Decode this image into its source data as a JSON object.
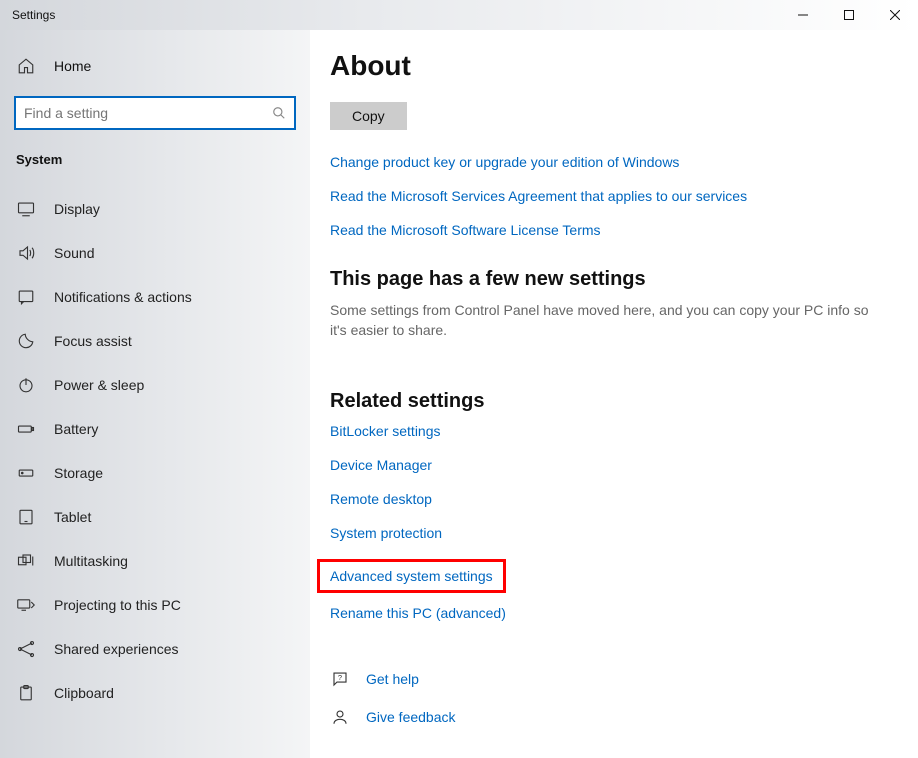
{
  "window": {
    "title": "Settings"
  },
  "sidebar": {
    "home": "Home",
    "search_placeholder": "Find a setting",
    "category": "System",
    "items": [
      {
        "icon": "display-icon",
        "label": "Display"
      },
      {
        "icon": "sound-icon",
        "label": "Sound"
      },
      {
        "icon": "notifications-icon",
        "label": "Notifications & actions"
      },
      {
        "icon": "focus-assist-icon",
        "label": "Focus assist"
      },
      {
        "icon": "power-sleep-icon",
        "label": "Power & sleep"
      },
      {
        "icon": "battery-icon",
        "label": "Battery"
      },
      {
        "icon": "storage-icon",
        "label": "Storage"
      },
      {
        "icon": "tablet-icon",
        "label": "Tablet"
      },
      {
        "icon": "multitasking-icon",
        "label": "Multitasking"
      },
      {
        "icon": "projecting-icon",
        "label": "Projecting to this PC"
      },
      {
        "icon": "shared-experiences-icon",
        "label": "Shared experiences"
      },
      {
        "icon": "clipboard-icon",
        "label": "Clipboard"
      }
    ]
  },
  "main": {
    "title": "About",
    "copy_label": "Copy",
    "top_links": [
      "Change product key or upgrade your edition of Windows",
      "Read the Microsoft Services Agreement that applies to our services",
      "Read the Microsoft Software License Terms"
    ],
    "new_settings_heading": "This page has a few new settings",
    "new_settings_desc": "Some settings from Control Panel have moved here, and you can copy your PC info so it's easier to share.",
    "related_heading": "Related settings",
    "related_links": [
      "BitLocker settings",
      "Device Manager",
      "Remote desktop",
      "System protection",
      "Advanced system settings",
      "Rename this PC (advanced)"
    ],
    "highlighted_index": 4,
    "get_help": "Get help",
    "give_feedback": "Give feedback"
  }
}
